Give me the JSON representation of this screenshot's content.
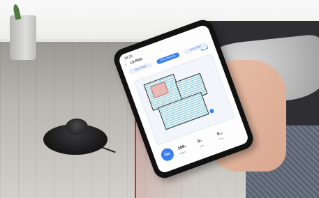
{
  "app": {
    "status_time": "18:21",
    "title": "L8 PRO",
    "back_icon": "chevron-left-icon",
    "tabs": [
      {
        "label": "Auto Clean",
        "active": false
      },
      {
        "label": "Zone Cleaning",
        "active": true
      },
      {
        "label": "Spot Clean",
        "active": false
      }
    ],
    "go_label": "Go",
    "stats": [
      {
        "value": "100",
        "unit": "%",
        "label": "Battery"
      },
      {
        "value": "0",
        "unit": "m²",
        "label": "Area"
      },
      {
        "value": "0",
        "unit": "min",
        "label": "Time"
      }
    ]
  },
  "colors": {
    "accent": "#3a7ff0",
    "laser": "#e02424"
  }
}
